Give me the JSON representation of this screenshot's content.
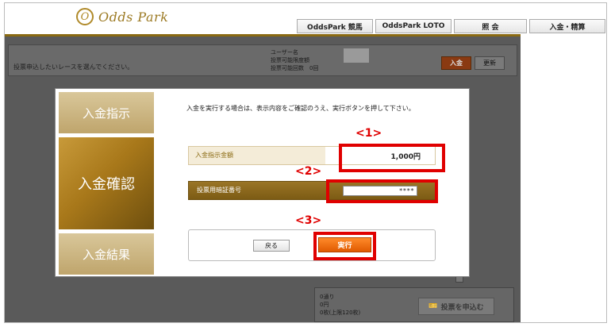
{
  "header": {
    "logo_mark": "O",
    "logo_text": "Odds Park",
    "nav": [
      "OddsPark 競馬",
      "OddsPark LOTO",
      "照 会",
      "入金・精算"
    ]
  },
  "background": {
    "instruction": "投票申込したいレースを選んでください。",
    "user_labels": [
      "ユーザー名",
      "投票可能限度額",
      "投票可能回数"
    ],
    "user_count_value": "0回",
    "deposit_button": "入金",
    "refresh_button": "更新",
    "footer_lines": [
      "0通り",
      "0円",
      "0枚(上限120枚)"
    ],
    "vote_button": "投票を申込む"
  },
  "modal": {
    "steps": [
      "入金指示",
      "入金確認",
      "入金結果"
    ],
    "instruction": "入金を実行する場合は、表示内容をご確認のうえ、実行ボタンを押して下さい。",
    "amount_label": "入金指示金額",
    "amount_value": "1,000円",
    "pin_label": "投票用暗証番号",
    "pin_value": "****",
    "back_button": "戻る",
    "execute_button": "実行"
  },
  "markers": [
    "<1>",
    "<2>",
    "<3>"
  ],
  "colors": {
    "highlight": "#e00000",
    "gold": "#a8781a",
    "execute": "#e05a00"
  }
}
